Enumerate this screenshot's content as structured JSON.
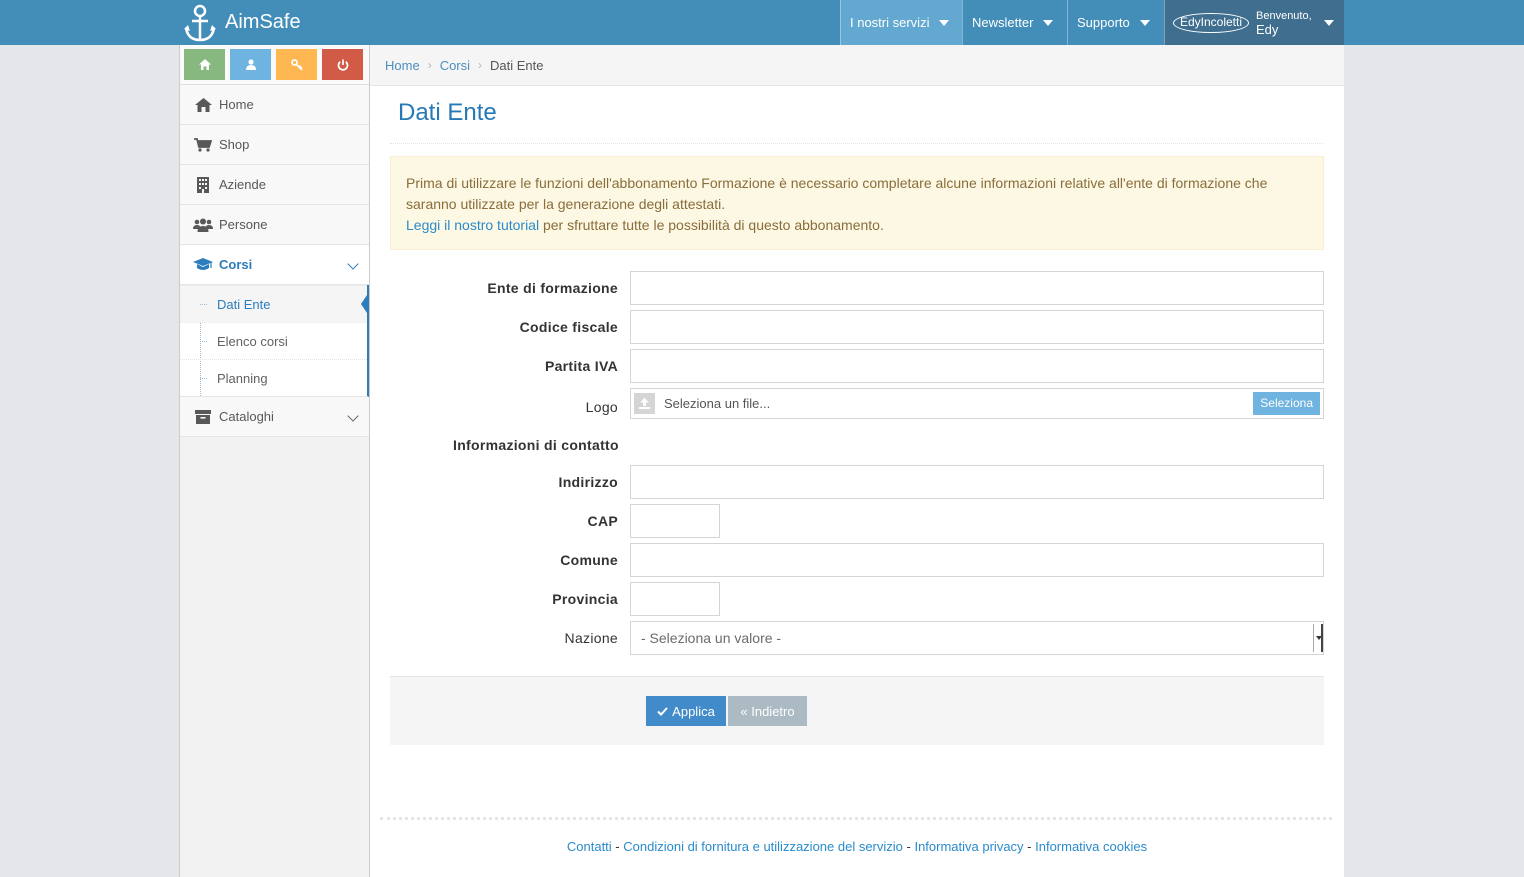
{
  "app": {
    "brand": "AimSafe"
  },
  "navbar": {
    "services": "I nostri servizi",
    "newsletter": "Newsletter",
    "support": "Supporto",
    "user_handle": "EdyIncoletti",
    "welcome": "Benvenuto,",
    "user_name": "Edy"
  },
  "sidebar": {
    "items": [
      {
        "label": "Home",
        "icon": "home-icon"
      },
      {
        "label": "Shop",
        "icon": "cart-icon"
      },
      {
        "label": "Aziende",
        "icon": "building-icon"
      },
      {
        "label": "Persone",
        "icon": "users-icon"
      },
      {
        "label": "Corsi",
        "icon": "graduation-cap-icon"
      },
      {
        "label": "Cataloghi",
        "icon": "archive-icon"
      }
    ],
    "subitems": [
      {
        "label": "Dati Ente"
      },
      {
        "label": "Elenco corsi"
      },
      {
        "label": "Planning"
      }
    ]
  },
  "breadcrumb": {
    "home": "Home",
    "corsi": "Corsi",
    "current": "Dati Ente"
  },
  "page": {
    "title": "Dati Ente"
  },
  "alert": {
    "text": "Prima di utilizzare le funzioni dell'abbonamento Formazione è necessario completare alcune informazioni relative all'ente di formazione che saranno utilizzate per la generazione degli attestati.",
    "link": "Leggi il nostro tutorial",
    "after_link": " per sfruttare tutte le possibilità di questo abbonamento."
  },
  "form": {
    "ente": "Ente di formazione",
    "codice_fiscale": "Codice fiscale",
    "partita_iva": "Partita IVA",
    "logo": "Logo",
    "logo_placeholder": "Seleziona un file...",
    "logo_button": "Seleziona",
    "contact_section": "Informazioni di contatto",
    "indirizzo": "Indirizzo",
    "cap": "CAP",
    "comune": "Comune",
    "provincia": "Provincia",
    "nazione": "Nazione",
    "nazione_value": "- Seleziona un valore -",
    "apply": "Applica",
    "back": "« Indietro"
  },
  "footer": {
    "contatti": "Contatti",
    "condizioni": "Condizioni di fornitura e utilizzazione del servizio",
    "privacy": "Informativa privacy",
    "cookies": "Informativa cookies",
    "sep": " - "
  },
  "colors": {
    "navbar": "#438eb9",
    "accent": "#2b7dbc",
    "alert_bg": "#fcf8e3",
    "apply": "#428bca"
  }
}
